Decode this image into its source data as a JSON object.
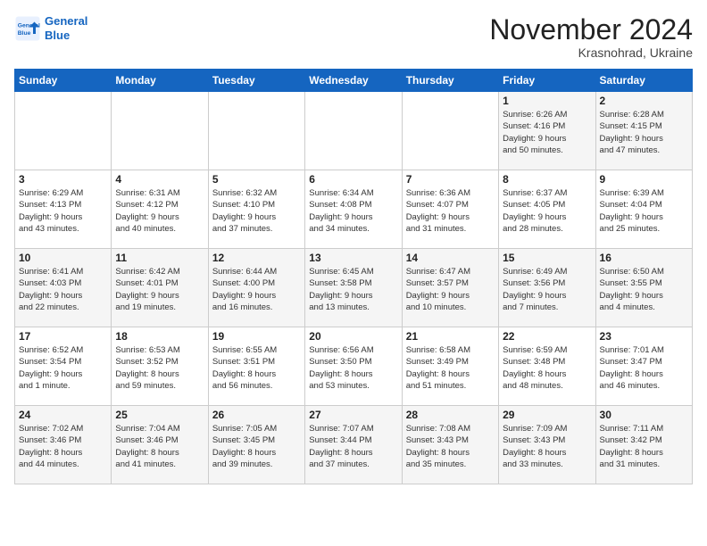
{
  "header": {
    "logo_line1": "General",
    "logo_line2": "Blue",
    "month": "November 2024",
    "location": "Krasnohrad, Ukraine"
  },
  "weekdays": [
    "Sunday",
    "Monday",
    "Tuesday",
    "Wednesday",
    "Thursday",
    "Friday",
    "Saturday"
  ],
  "weeks": [
    [
      {
        "day": "",
        "content": ""
      },
      {
        "day": "",
        "content": ""
      },
      {
        "day": "",
        "content": ""
      },
      {
        "day": "",
        "content": ""
      },
      {
        "day": "",
        "content": ""
      },
      {
        "day": "1",
        "content": "Sunrise: 6:26 AM\nSunset: 4:16 PM\nDaylight: 9 hours\nand 50 minutes."
      },
      {
        "day": "2",
        "content": "Sunrise: 6:28 AM\nSunset: 4:15 PM\nDaylight: 9 hours\nand 47 minutes."
      }
    ],
    [
      {
        "day": "3",
        "content": "Sunrise: 6:29 AM\nSunset: 4:13 PM\nDaylight: 9 hours\nand 43 minutes."
      },
      {
        "day": "4",
        "content": "Sunrise: 6:31 AM\nSunset: 4:12 PM\nDaylight: 9 hours\nand 40 minutes."
      },
      {
        "day": "5",
        "content": "Sunrise: 6:32 AM\nSunset: 4:10 PM\nDaylight: 9 hours\nand 37 minutes."
      },
      {
        "day": "6",
        "content": "Sunrise: 6:34 AM\nSunset: 4:08 PM\nDaylight: 9 hours\nand 34 minutes."
      },
      {
        "day": "7",
        "content": "Sunrise: 6:36 AM\nSunset: 4:07 PM\nDaylight: 9 hours\nand 31 minutes."
      },
      {
        "day": "8",
        "content": "Sunrise: 6:37 AM\nSunset: 4:05 PM\nDaylight: 9 hours\nand 28 minutes."
      },
      {
        "day": "9",
        "content": "Sunrise: 6:39 AM\nSunset: 4:04 PM\nDaylight: 9 hours\nand 25 minutes."
      }
    ],
    [
      {
        "day": "10",
        "content": "Sunrise: 6:41 AM\nSunset: 4:03 PM\nDaylight: 9 hours\nand 22 minutes."
      },
      {
        "day": "11",
        "content": "Sunrise: 6:42 AM\nSunset: 4:01 PM\nDaylight: 9 hours\nand 19 minutes."
      },
      {
        "day": "12",
        "content": "Sunrise: 6:44 AM\nSunset: 4:00 PM\nDaylight: 9 hours\nand 16 minutes."
      },
      {
        "day": "13",
        "content": "Sunrise: 6:45 AM\nSunset: 3:58 PM\nDaylight: 9 hours\nand 13 minutes."
      },
      {
        "day": "14",
        "content": "Sunrise: 6:47 AM\nSunset: 3:57 PM\nDaylight: 9 hours\nand 10 minutes."
      },
      {
        "day": "15",
        "content": "Sunrise: 6:49 AM\nSunset: 3:56 PM\nDaylight: 9 hours\nand 7 minutes."
      },
      {
        "day": "16",
        "content": "Sunrise: 6:50 AM\nSunset: 3:55 PM\nDaylight: 9 hours\nand 4 minutes."
      }
    ],
    [
      {
        "day": "17",
        "content": "Sunrise: 6:52 AM\nSunset: 3:54 PM\nDaylight: 9 hours\nand 1 minute."
      },
      {
        "day": "18",
        "content": "Sunrise: 6:53 AM\nSunset: 3:52 PM\nDaylight: 8 hours\nand 59 minutes."
      },
      {
        "day": "19",
        "content": "Sunrise: 6:55 AM\nSunset: 3:51 PM\nDaylight: 8 hours\nand 56 minutes."
      },
      {
        "day": "20",
        "content": "Sunrise: 6:56 AM\nSunset: 3:50 PM\nDaylight: 8 hours\nand 53 minutes."
      },
      {
        "day": "21",
        "content": "Sunrise: 6:58 AM\nSunset: 3:49 PM\nDaylight: 8 hours\nand 51 minutes."
      },
      {
        "day": "22",
        "content": "Sunrise: 6:59 AM\nSunset: 3:48 PM\nDaylight: 8 hours\nand 48 minutes."
      },
      {
        "day": "23",
        "content": "Sunrise: 7:01 AM\nSunset: 3:47 PM\nDaylight: 8 hours\nand 46 minutes."
      }
    ],
    [
      {
        "day": "24",
        "content": "Sunrise: 7:02 AM\nSunset: 3:46 PM\nDaylight: 8 hours\nand 44 minutes."
      },
      {
        "day": "25",
        "content": "Sunrise: 7:04 AM\nSunset: 3:46 PM\nDaylight: 8 hours\nand 41 minutes."
      },
      {
        "day": "26",
        "content": "Sunrise: 7:05 AM\nSunset: 3:45 PM\nDaylight: 8 hours\nand 39 minutes."
      },
      {
        "day": "27",
        "content": "Sunrise: 7:07 AM\nSunset: 3:44 PM\nDaylight: 8 hours\nand 37 minutes."
      },
      {
        "day": "28",
        "content": "Sunrise: 7:08 AM\nSunset: 3:43 PM\nDaylight: 8 hours\nand 35 minutes."
      },
      {
        "day": "29",
        "content": "Sunrise: 7:09 AM\nSunset: 3:43 PM\nDaylight: 8 hours\nand 33 minutes."
      },
      {
        "day": "30",
        "content": "Sunrise: 7:11 AM\nSunset: 3:42 PM\nDaylight: 8 hours\nand 31 minutes."
      }
    ]
  ]
}
